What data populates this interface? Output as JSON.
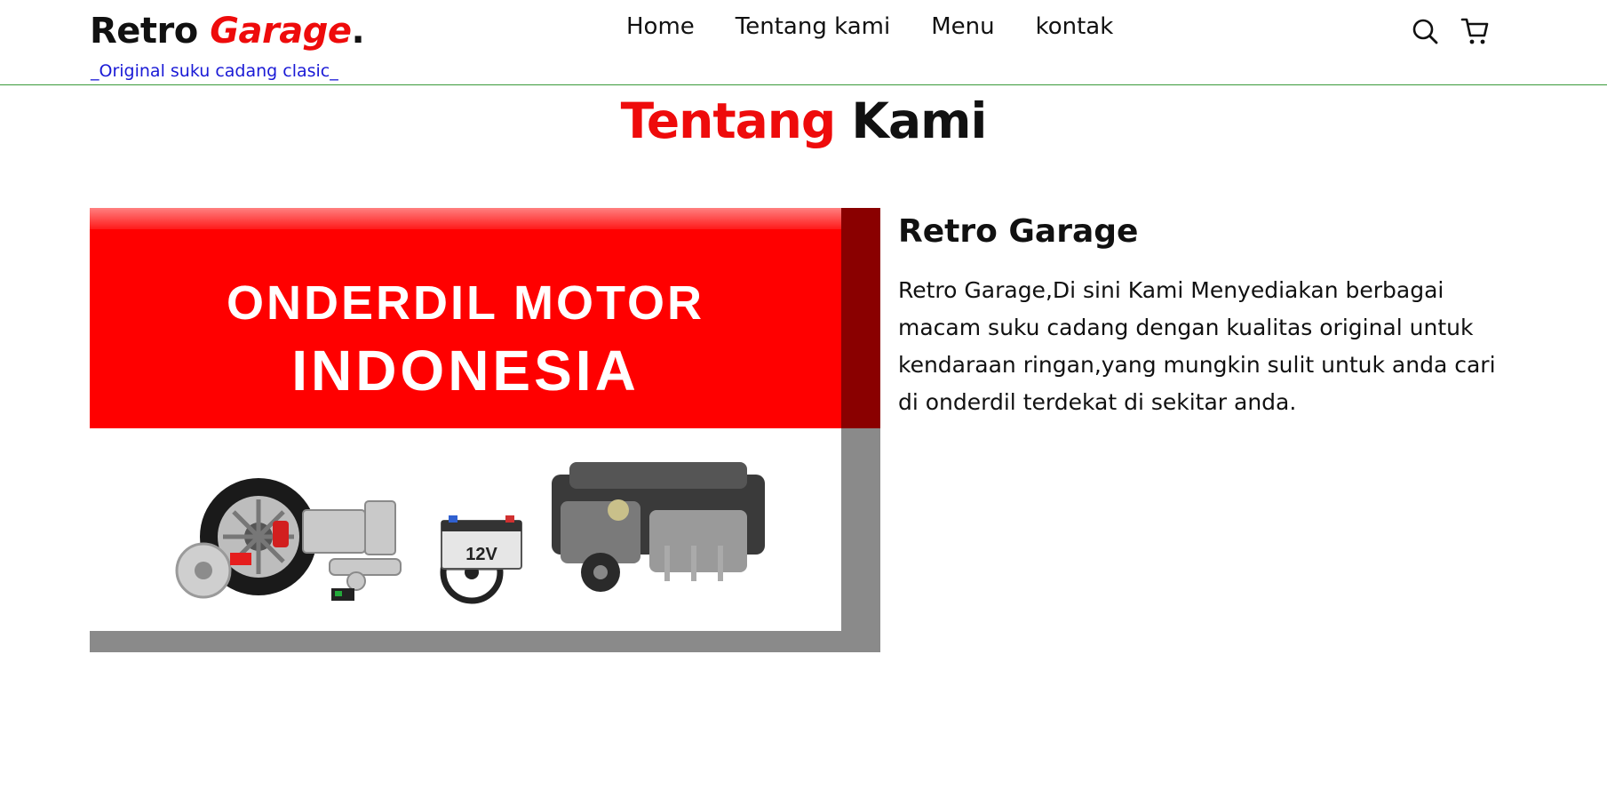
{
  "header": {
    "logo_main": "Retro ",
    "logo_accent": "Garage",
    "logo_dot": ".",
    "tagline": "_Original suku cadang clasic_",
    "nav": [
      "Home",
      "Tentang kami",
      "Menu",
      "kontak"
    ],
    "icons": [
      "search-icon",
      "shopping-cart-icon"
    ]
  },
  "about": {
    "title_accent": "Tentang",
    "title_rest": "Kami",
    "banner_line1": "ONDERDIL MOTOR",
    "banner_line2": "INDONESIA",
    "banner_label_12v": "12V",
    "heading": "Retro Garage",
    "description": "Retro Garage,Di sini Kami Menyediakan berbagai macam suku cadang dengan kualitas original untuk kendaraan ringan,yang mungkin sulit untuk anda cari di onderdil terdekat di sekitar anda."
  },
  "colors": {
    "accent_red": "#ee0b0b",
    "tagline_blue": "#1a1ad6",
    "divider_green": "#3a9a3a"
  }
}
